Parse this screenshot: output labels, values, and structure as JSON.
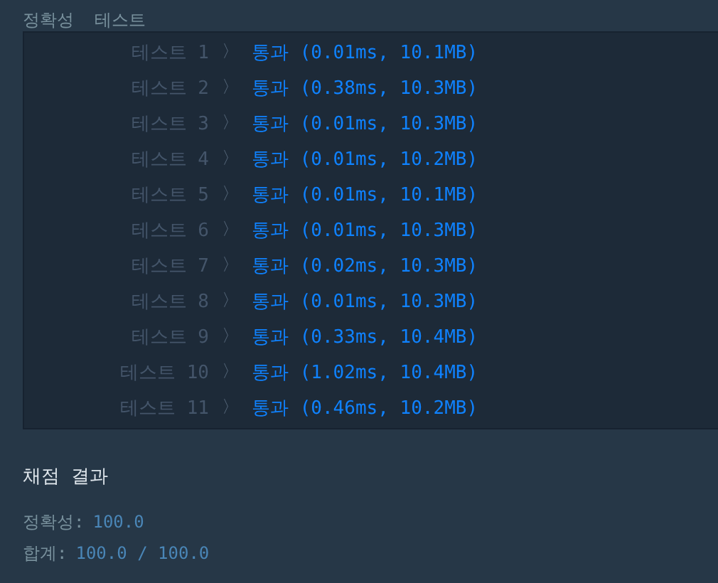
{
  "header": {
    "title": "정확성  테스트"
  },
  "tests": [
    {
      "label": "테스트 1",
      "separator": "〉",
      "result": "통과 (0.01ms, 10.1MB)"
    },
    {
      "label": "테스트 2",
      "separator": "〉",
      "result": "통과 (0.38ms, 10.3MB)"
    },
    {
      "label": "테스트 3",
      "separator": "〉",
      "result": "통과 (0.01ms, 10.3MB)"
    },
    {
      "label": "테스트 4",
      "separator": "〉",
      "result": "통과 (0.01ms, 10.2MB)"
    },
    {
      "label": "테스트 5",
      "separator": "〉",
      "result": "통과 (0.01ms, 10.1MB)"
    },
    {
      "label": "테스트 6",
      "separator": "〉",
      "result": "통과 (0.01ms, 10.3MB)"
    },
    {
      "label": "테스트 7",
      "separator": "〉",
      "result": "통과 (0.02ms, 10.3MB)"
    },
    {
      "label": "테스트 8",
      "separator": "〉",
      "result": "통과 (0.01ms, 10.3MB)"
    },
    {
      "label": "테스트 9",
      "separator": "〉",
      "result": "통과 (0.33ms, 10.4MB)"
    },
    {
      "label": "테스트 10",
      "separator": "〉",
      "result": "통과 (1.02ms, 10.4MB)"
    },
    {
      "label": "테스트 11",
      "separator": "〉",
      "result": "통과 (0.46ms, 10.2MB)"
    }
  ],
  "summary": {
    "title": "채점 결과",
    "lines": [
      {
        "label": "정확성:",
        "value": "100.0"
      },
      {
        "label": "합계:",
        "value": "100.0 / 100.0"
      }
    ]
  }
}
